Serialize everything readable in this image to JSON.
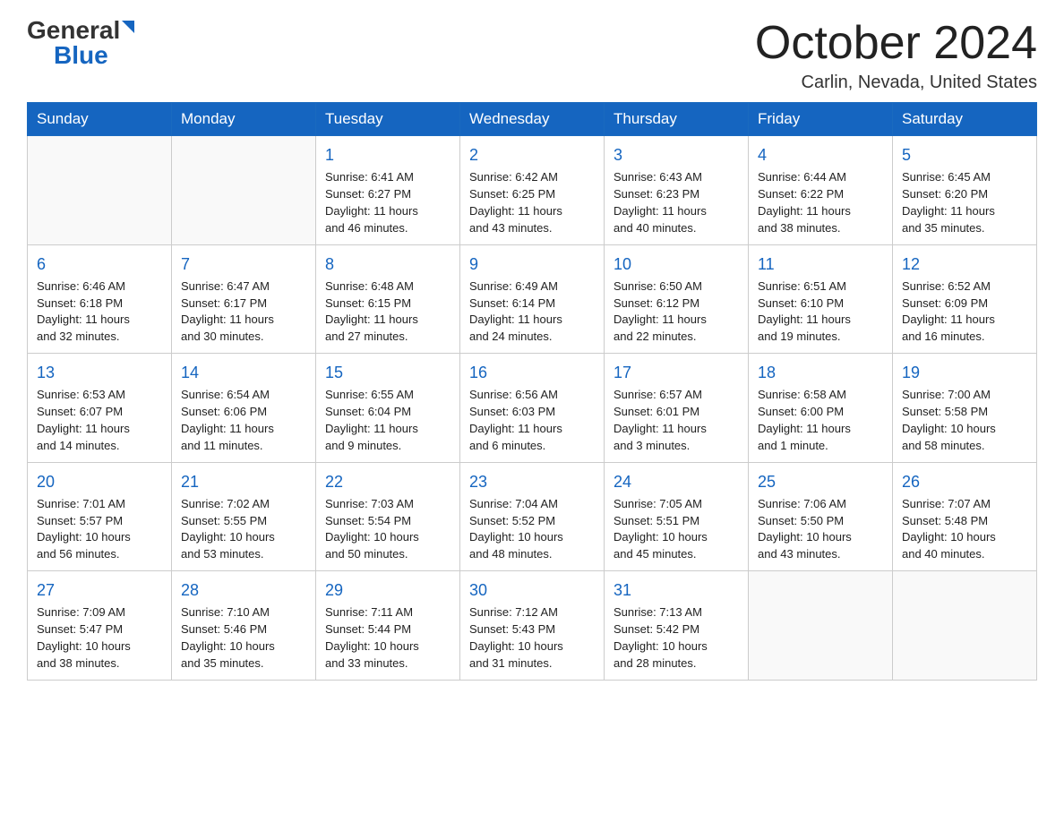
{
  "logo": {
    "general": "General",
    "blue": "Blue"
  },
  "header": {
    "title": "October 2024",
    "location": "Carlin, Nevada, United States"
  },
  "weekdays": [
    "Sunday",
    "Monday",
    "Tuesday",
    "Wednesday",
    "Thursday",
    "Friday",
    "Saturday"
  ],
  "weeks": [
    [
      {
        "day": "",
        "info": ""
      },
      {
        "day": "",
        "info": ""
      },
      {
        "day": "1",
        "info": "Sunrise: 6:41 AM\nSunset: 6:27 PM\nDaylight: 11 hours\nand 46 minutes."
      },
      {
        "day": "2",
        "info": "Sunrise: 6:42 AM\nSunset: 6:25 PM\nDaylight: 11 hours\nand 43 minutes."
      },
      {
        "day": "3",
        "info": "Sunrise: 6:43 AM\nSunset: 6:23 PM\nDaylight: 11 hours\nand 40 minutes."
      },
      {
        "day": "4",
        "info": "Sunrise: 6:44 AM\nSunset: 6:22 PM\nDaylight: 11 hours\nand 38 minutes."
      },
      {
        "day": "5",
        "info": "Sunrise: 6:45 AM\nSunset: 6:20 PM\nDaylight: 11 hours\nand 35 minutes."
      }
    ],
    [
      {
        "day": "6",
        "info": "Sunrise: 6:46 AM\nSunset: 6:18 PM\nDaylight: 11 hours\nand 32 minutes."
      },
      {
        "day": "7",
        "info": "Sunrise: 6:47 AM\nSunset: 6:17 PM\nDaylight: 11 hours\nand 30 minutes."
      },
      {
        "day": "8",
        "info": "Sunrise: 6:48 AM\nSunset: 6:15 PM\nDaylight: 11 hours\nand 27 minutes."
      },
      {
        "day": "9",
        "info": "Sunrise: 6:49 AM\nSunset: 6:14 PM\nDaylight: 11 hours\nand 24 minutes."
      },
      {
        "day": "10",
        "info": "Sunrise: 6:50 AM\nSunset: 6:12 PM\nDaylight: 11 hours\nand 22 minutes."
      },
      {
        "day": "11",
        "info": "Sunrise: 6:51 AM\nSunset: 6:10 PM\nDaylight: 11 hours\nand 19 minutes."
      },
      {
        "day": "12",
        "info": "Sunrise: 6:52 AM\nSunset: 6:09 PM\nDaylight: 11 hours\nand 16 minutes."
      }
    ],
    [
      {
        "day": "13",
        "info": "Sunrise: 6:53 AM\nSunset: 6:07 PM\nDaylight: 11 hours\nand 14 minutes."
      },
      {
        "day": "14",
        "info": "Sunrise: 6:54 AM\nSunset: 6:06 PM\nDaylight: 11 hours\nand 11 minutes."
      },
      {
        "day": "15",
        "info": "Sunrise: 6:55 AM\nSunset: 6:04 PM\nDaylight: 11 hours\nand 9 minutes."
      },
      {
        "day": "16",
        "info": "Sunrise: 6:56 AM\nSunset: 6:03 PM\nDaylight: 11 hours\nand 6 minutes."
      },
      {
        "day": "17",
        "info": "Sunrise: 6:57 AM\nSunset: 6:01 PM\nDaylight: 11 hours\nand 3 minutes."
      },
      {
        "day": "18",
        "info": "Sunrise: 6:58 AM\nSunset: 6:00 PM\nDaylight: 11 hours\nand 1 minute."
      },
      {
        "day": "19",
        "info": "Sunrise: 7:00 AM\nSunset: 5:58 PM\nDaylight: 10 hours\nand 58 minutes."
      }
    ],
    [
      {
        "day": "20",
        "info": "Sunrise: 7:01 AM\nSunset: 5:57 PM\nDaylight: 10 hours\nand 56 minutes."
      },
      {
        "day": "21",
        "info": "Sunrise: 7:02 AM\nSunset: 5:55 PM\nDaylight: 10 hours\nand 53 minutes."
      },
      {
        "day": "22",
        "info": "Sunrise: 7:03 AM\nSunset: 5:54 PM\nDaylight: 10 hours\nand 50 minutes."
      },
      {
        "day": "23",
        "info": "Sunrise: 7:04 AM\nSunset: 5:52 PM\nDaylight: 10 hours\nand 48 minutes."
      },
      {
        "day": "24",
        "info": "Sunrise: 7:05 AM\nSunset: 5:51 PM\nDaylight: 10 hours\nand 45 minutes."
      },
      {
        "day": "25",
        "info": "Sunrise: 7:06 AM\nSunset: 5:50 PM\nDaylight: 10 hours\nand 43 minutes."
      },
      {
        "day": "26",
        "info": "Sunrise: 7:07 AM\nSunset: 5:48 PM\nDaylight: 10 hours\nand 40 minutes."
      }
    ],
    [
      {
        "day": "27",
        "info": "Sunrise: 7:09 AM\nSunset: 5:47 PM\nDaylight: 10 hours\nand 38 minutes."
      },
      {
        "day": "28",
        "info": "Sunrise: 7:10 AM\nSunset: 5:46 PM\nDaylight: 10 hours\nand 35 minutes."
      },
      {
        "day": "29",
        "info": "Sunrise: 7:11 AM\nSunset: 5:44 PM\nDaylight: 10 hours\nand 33 minutes."
      },
      {
        "day": "30",
        "info": "Sunrise: 7:12 AM\nSunset: 5:43 PM\nDaylight: 10 hours\nand 31 minutes."
      },
      {
        "day": "31",
        "info": "Sunrise: 7:13 AM\nSunset: 5:42 PM\nDaylight: 10 hours\nand 28 minutes."
      },
      {
        "day": "",
        "info": ""
      },
      {
        "day": "",
        "info": ""
      }
    ]
  ]
}
